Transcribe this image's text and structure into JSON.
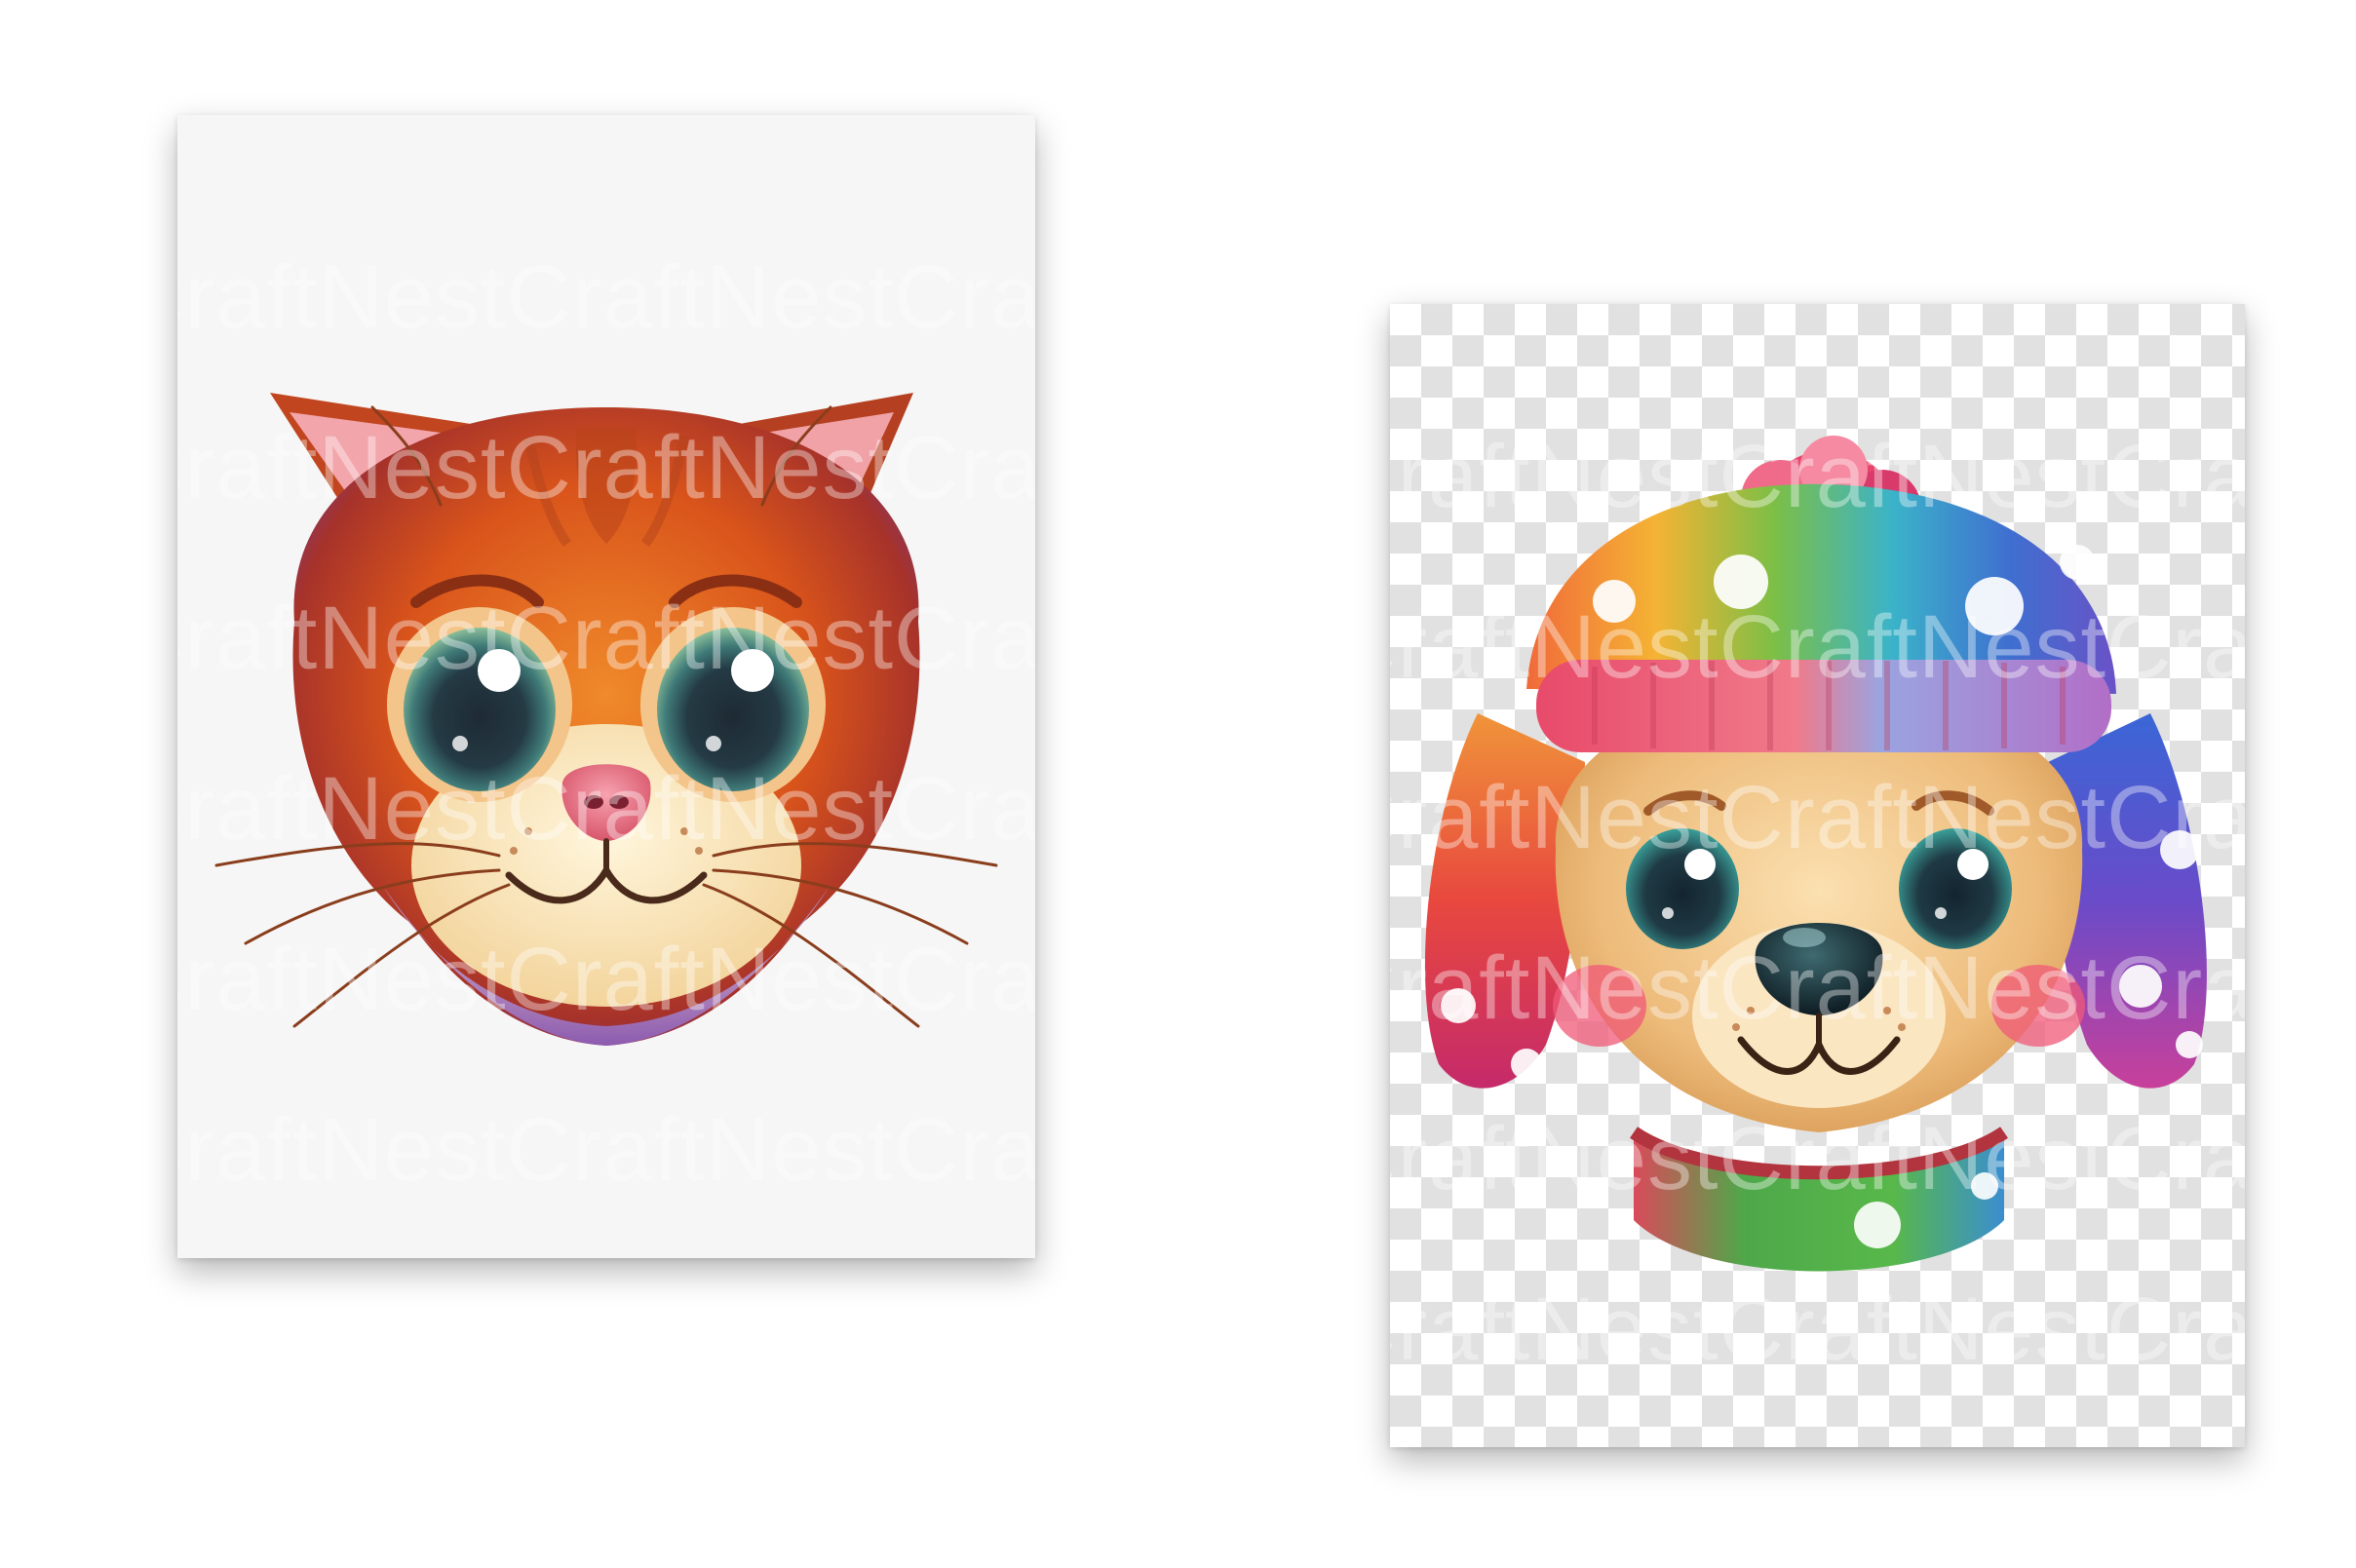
{
  "watermark": {
    "text": "CraftNestCraftNestCraftNestCraftNest",
    "color": "#ffffff"
  },
  "cards": [
    {
      "subject": "cat-face",
      "background": "#f6f6f6"
    },
    {
      "subject": "puppy-with-rainbow-hat",
      "background": "transparency-checkerboard"
    }
  ]
}
